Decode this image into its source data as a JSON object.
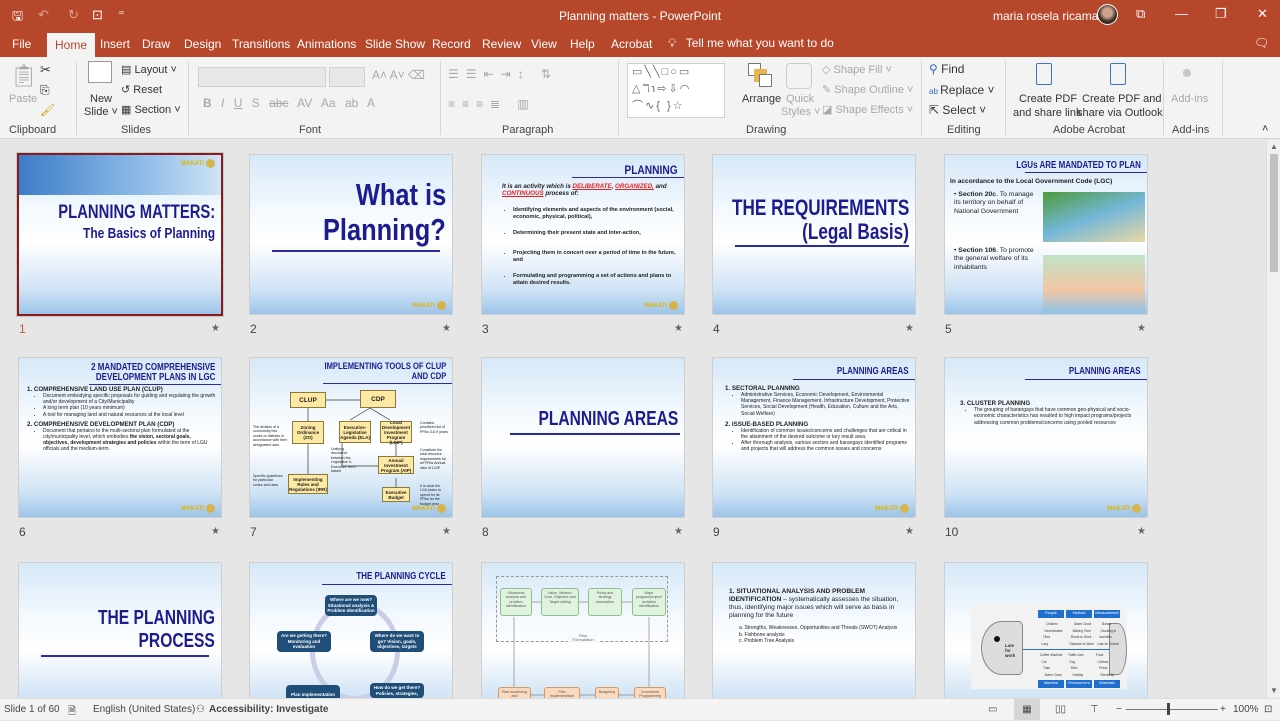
{
  "window": {
    "title": "Planning matters  -  PowerPoint",
    "user": "maria rosela ricamara",
    "qa_save": "🖫",
    "qa_undo": "↶",
    "qa_redo": "↻",
    "qa_present": "⊡",
    "qa_more": "⁼",
    "restore": "⧉",
    "minimize": "—",
    "maximize": "❐",
    "close": "✕"
  },
  "tabs": [
    "File",
    "Home",
    "Insert",
    "Draw",
    "Design",
    "Transitions",
    "Animations",
    "Slide Show",
    "Record",
    "Review",
    "View",
    "Help",
    "Acrobat"
  ],
  "tell_me": "Tell me what you want to do",
  "ribbon": {
    "clipboard": {
      "label": "Clipboard",
      "paste": "Paste"
    },
    "slides": {
      "label": "Slides",
      "new_slide": "New",
      "new_slide2": "Slide ˅",
      "layout": "Layout ˅",
      "reset": "Reset",
      "section": "Section ˅"
    },
    "font": {
      "label": "Font",
      "buttons": [
        "B",
        "I",
        "U",
        "S",
        "abc",
        "AV",
        "Aa",
        "ab",
        "A"
      ]
    },
    "paragraph": {
      "label": "Paragraph"
    },
    "drawing": {
      "label": "Drawing",
      "arrange": "Arrange",
      "quick_styles": "Quick",
      "quick_styles2": "Styles ˅",
      "shape_fill": "Shape Fill ˅",
      "shape_outline": "Shape Outline ˅",
      "shape_effects": "Shape Effects ˅",
      "shapes_gallery": "▭╲╲□○▭ △ℸ℩⇨⇩◠ ⌒∿{ }☆"
    },
    "editing": {
      "label": "Editing",
      "find": "Find",
      "replace": "Replace",
      "select": "Select ˅"
    },
    "acrobat": {
      "label": "Adobe Acrobat",
      "create_pdf": "Create PDF",
      "create_pdf2": "and share link",
      "create_pdf_outlook": "Create PDF and",
      "create_pdf_outlook2": "share via Outlook"
    },
    "addins": {
      "label": "Add-ins",
      "addins_btn": "Add-ins"
    }
  },
  "slides": [
    {
      "number": "1",
      "title": "PLANNING MATTERS:",
      "subtitle": "The Basics of Planning",
      "logo": "MAKATI"
    },
    {
      "number": "2",
      "title": "What is",
      "title2": "Planning?",
      "logo": "MAKATI"
    },
    {
      "number": "3",
      "title": "PLANNING",
      "intro_a": "It is an activity which is ",
      "deliberate": "DELIBERATE",
      "comma": ", ",
      "organized": "ORGANIZED,",
      "and": " and ",
      "continuous": "CONTINUOUS",
      "intro_b": " process of:",
      "bullets": [
        "Identifying elements and aspects of the environment (social, economic, physical, political),",
        "Determining their present state and inter-action,",
        "Projecting them in concert over a period of time in the future, and",
        "Formulating and programming a set of actions and plans to attain desired results."
      ],
      "logo": "MAKATI"
    },
    {
      "number": "4",
      "title": "THE REQUIREMENTS",
      "title2": "(Legal Basis)"
    },
    {
      "number": "5",
      "title": "LGUs ARE MANDATED TO PLAN",
      "lead": "In accordance to the Local Government Code (LGC)",
      "b1_bold": "Section 20c",
      "b1": ". To manage its territory on behalf of National Government",
      "b2_bold": "Section 106",
      "b2": ". To promote the general welfare of its inhabitants"
    },
    {
      "number": "6",
      "title": "2 MANDATED COMPREHENSIVE",
      "title2": "DEVELOPMENT PLANS IN LGC",
      "h1": "1. COMPREHENSIVE LAND USE PLAN (CLUP)",
      "h1_bullets": [
        "Document embodying specific proposals for guiding and regulating the growth and/or development of a City/Municipality",
        "A long term plan (10 years minimum)",
        "A tool for managing land and natural resources at the local level"
      ],
      "h2": "2. COMPREHENSIVE DEVELOPMENT PLAN (CDP)",
      "h2_text": "Document that pertains to the multi-sectoral plan formulated at the city/municipality level, which embodies ",
      "h2_bold": "the vision, sectoral goals, objectives, development strategies and policies",
      "h2_tail": " within the term of LGU officials and the medium-term.",
      "logo": "MAKATI"
    },
    {
      "number": "7",
      "title": "IMPLEMENTING TOOLS OF CLUP",
      "title2": "AND CDP",
      "boxes": [
        "CLUP",
        "CDP",
        "Zoning Ordinance (ZO)",
        "Executive-Legislative Agenda (ELA)",
        "Local Development Investment Program (LDIP)",
        "Annual Investment Program (AIP)",
        "Implementing Rules and Regulations (IRR)",
        "Executive Budget"
      ],
      "notes": [
        "The division of a community into zones or districts in accordance with their designated uses",
        "Specific guidelines for particular zones and uses",
        "Unifying document between the Legislative & Executive Term based",
        "Contains prioritized list of PPAs 3-6-9 years",
        "Constitute the total resource requirements for all PPAs Annual slice of LDIP",
        "It is what the LGU plans to spend for its PPAs for the budget year"
      ],
      "logo": "MAKATI"
    },
    {
      "number": "8",
      "title": "PLANNING AREAS"
    },
    {
      "number": "9",
      "title": "PLANNING AREAS",
      "h1": "1. SECTORAL PLANNING",
      "h1_bullets": [
        "Administrative Services, Economic Development, Environmental Management, Finance Management, Infrastructure Development, Protective Services, Social Development (Health, Education, Culture and the Arts, Social Welfare)"
      ],
      "h2": "2. ISSUE-BASED PLANNING",
      "h2_bullets": [
        "Identification of common issues/concerns and challenges that are critical in the attainment of the desired outcome or key result area.",
        "After thorough analysis, various sectors and barangays identified programs and projects that will address the common issues and concerns"
      ],
      "logo": "MAKATI"
    },
    {
      "number": "10",
      "title": "PLANNING AREAS",
      "h1": "3. CLUSTER PLANNING",
      "h1_bullets": [
        "The grouping of barangays that have common geo-physical and socio-economic characteristics has resulted to high impact programs/projects addressing common problems/concerns using pooled resources"
      ],
      "logo": "MAKATI"
    },
    {
      "number": "11",
      "title": "THE PLANNING",
      "title2": "PROCESS"
    },
    {
      "number": "12",
      "title": "THE PLANNING CYCLE",
      "nodes": [
        "Where are we now? Situational analysis & Problem Identification",
        "Where do we want to go? Vision, goals, objectives, targets",
        "How do we get there? Policies, strategies,",
        "Plan implementation",
        "Are we getting there? Monitoring and evaluation"
      ]
    },
    {
      "number": "13",
      "top": [
        "Situational Analysis and problem identification",
        "Vision, Mission, Goal, Objective and Target setting",
        "Policy and strategy formulation",
        "Major program/project/ activities identification"
      ],
      "frame_label": "Plan Formulation",
      "bottom": [
        "Plan monitoring and",
        "Plan Implementation",
        "Budgeting",
        "Investment Programming"
      ]
    },
    {
      "number": "14",
      "h1": "1.  SITUATIONAL ANALYSIS AND PROBLEM IDENTIFICATION",
      "h1_tail": "  – systematically assesses the situation, thus, identifying major issues which will serve as basis in planning for the future",
      "items": [
        "a.   Strengths, Weaknesses, Opportunities and Threats (SWOT)  Analysis",
        "b.   Fishbone analysis",
        "c.   Problem Tree Analysis"
      ]
    },
    {
      "number": "15",
      "head": "Late for work",
      "cats_top": [
        "People",
        "Method",
        "Measurement"
      ],
      "cats_bottom": [
        "Machine",
        "Environment",
        "Materials"
      ],
      "causes": [
        "Children",
        "Alarm Clock",
        "Bonus",
        "Demotivated",
        "Waking Time",
        "Clocking In",
        "Tired",
        "Route to Work",
        "Incentive",
        "Lazy",
        "Distance to Work",
        "Late for School",
        "Coffee Machine",
        "Traffic Jam",
        "Food",
        "Car",
        "Fog",
        "Clothes",
        "Train",
        "Rain",
        "Petrol",
        "Alarm Clock",
        "Holiday",
        "Electricity"
      ]
    }
  ],
  "status": {
    "slide": "Slide 1 of 60",
    "language": "English (United States)",
    "accessibility": "Accessibility: Investigate",
    "zoom": "100%"
  }
}
